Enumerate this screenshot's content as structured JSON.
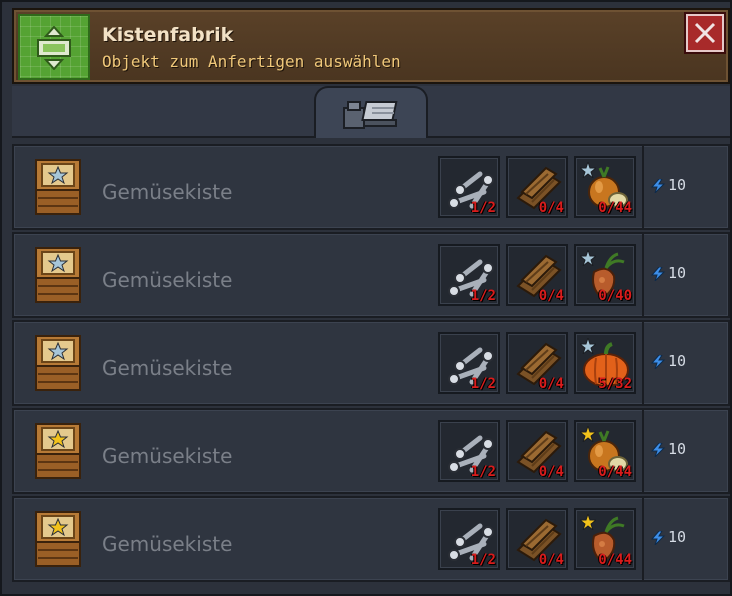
{
  "header": {
    "title": "Kistenfabrik",
    "subtitle": "Objekt zum Anfertigen auswählen",
    "icon": "factory-green-icon",
    "close_icon": "close-icon"
  },
  "tabs": [
    {
      "icon": "workbench-tools-icon",
      "active": true
    }
  ],
  "colors": {
    "header_bg": "#5a4128",
    "subtitle": "#f0c87a",
    "missing_count": "#d91c1c",
    "star_silver": "#a7c6d8",
    "star_gold": "#f2c21b"
  },
  "recipes": [
    {
      "name": "Gemüsekiste",
      "star": "silver",
      "energy": "10",
      "ingredients": [
        {
          "icon": "nails-icon",
          "count": "1/2"
        },
        {
          "icon": "wood-planks-icon",
          "count": "0/4"
        },
        {
          "icon": "onion-icon",
          "count": "0/44",
          "star": "silver"
        }
      ]
    },
    {
      "name": "Gemüsekiste",
      "star": "silver",
      "energy": "10",
      "ingredients": [
        {
          "icon": "nails-icon",
          "count": "1/2"
        },
        {
          "icon": "wood-planks-icon",
          "count": "0/4"
        },
        {
          "icon": "carrot-icon",
          "count": "0/40",
          "star": "silver"
        }
      ]
    },
    {
      "name": "Gemüsekiste",
      "star": "silver",
      "energy": "10",
      "ingredients": [
        {
          "icon": "nails-icon",
          "count": "1/2"
        },
        {
          "icon": "wood-planks-icon",
          "count": "0/4"
        },
        {
          "icon": "pumpkin-icon",
          "count": "5/32",
          "star": "silver"
        }
      ]
    },
    {
      "name": "Gemüsekiste",
      "star": "gold",
      "energy": "10",
      "ingredients": [
        {
          "icon": "nails-icon",
          "count": "1/2"
        },
        {
          "icon": "wood-planks-icon",
          "count": "0/4"
        },
        {
          "icon": "onion-icon",
          "count": "0/44",
          "star": "gold"
        }
      ]
    },
    {
      "name": "Gemüsekiste",
      "star": "gold",
      "energy": "10",
      "ingredients": [
        {
          "icon": "nails-icon",
          "count": "1/2"
        },
        {
          "icon": "wood-planks-icon",
          "count": "0/4"
        },
        {
          "icon": "carrot-icon",
          "count": "0/44",
          "star": "gold"
        }
      ]
    }
  ]
}
